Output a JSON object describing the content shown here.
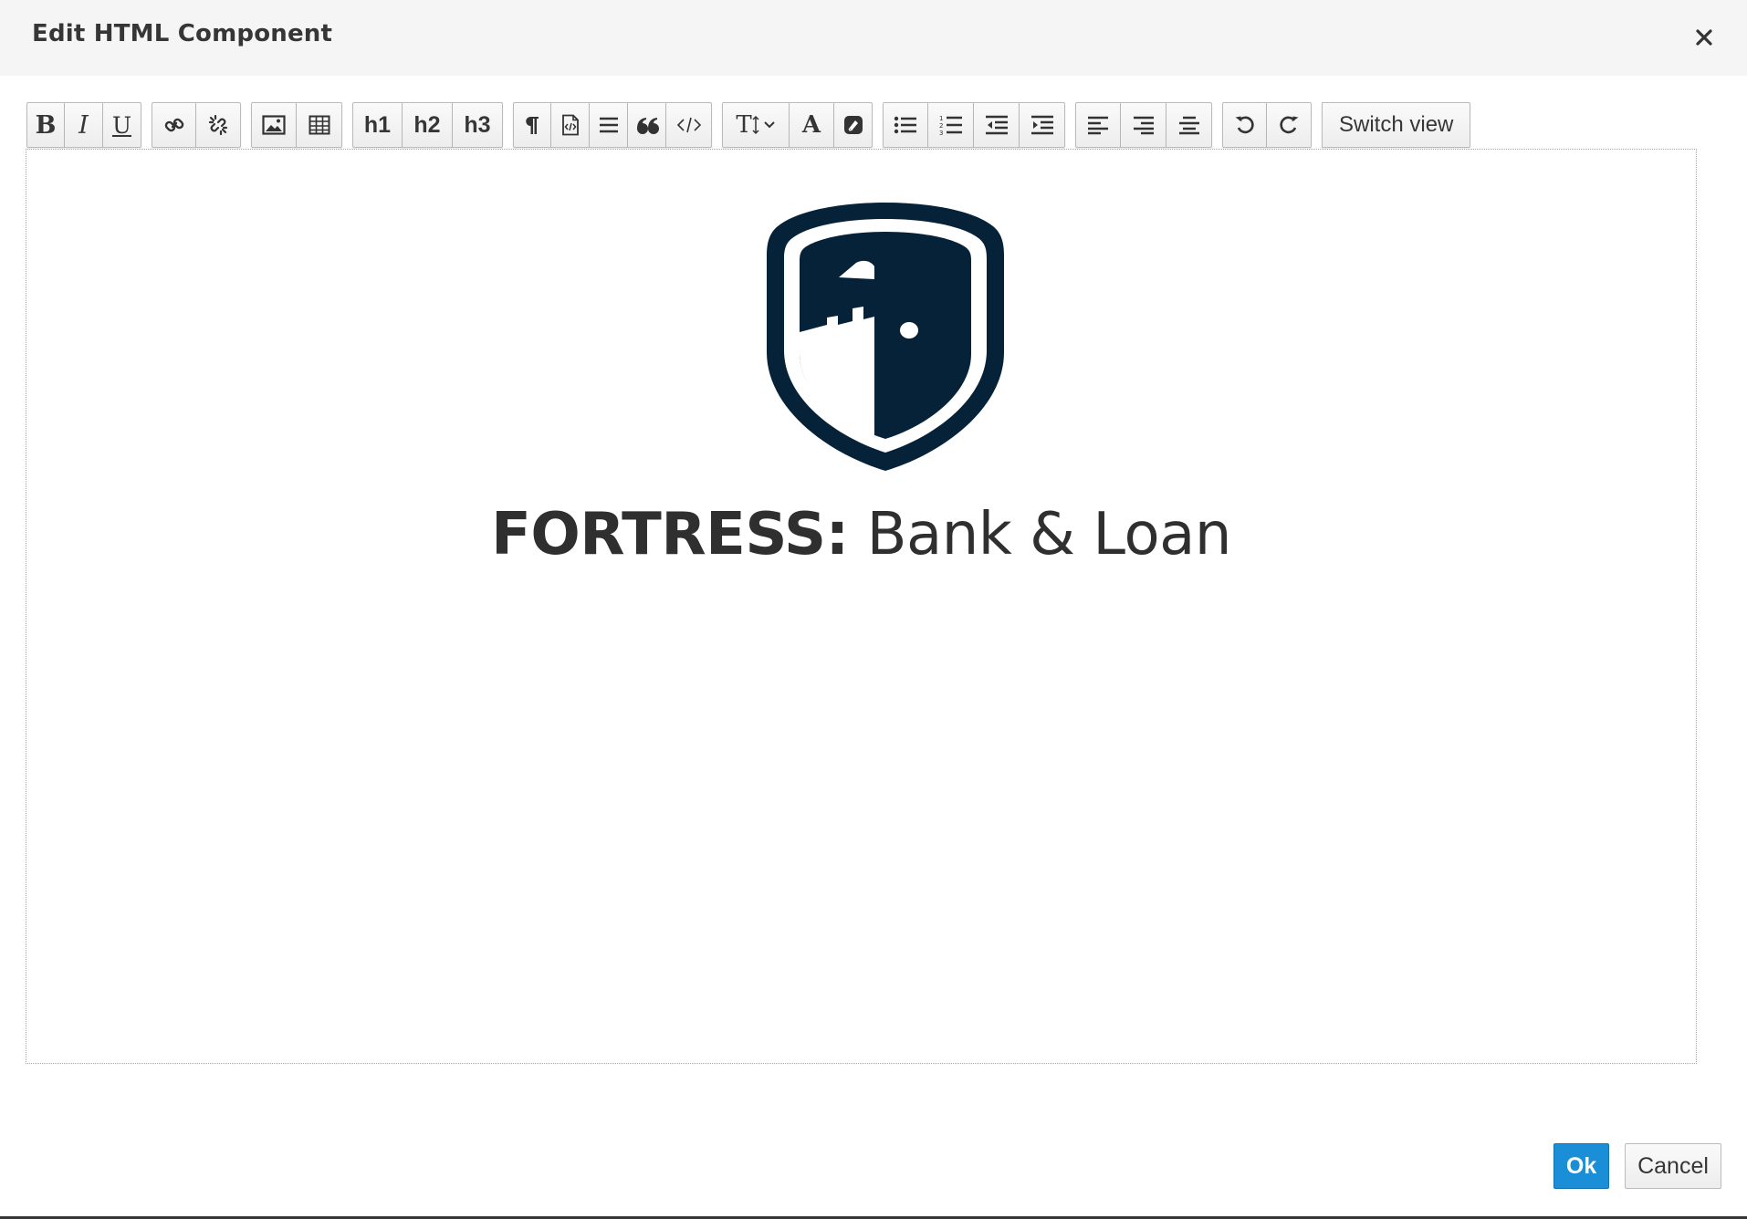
{
  "dialog": {
    "title": "Edit HTML Component",
    "close_icon": "close-icon"
  },
  "toolbar": {
    "groups": [
      {
        "name": "text-style",
        "buttons": [
          {
            "label": "B",
            "icon": "bold-icon"
          },
          {
            "label": "I",
            "icon": "italic-icon"
          },
          {
            "label": "U",
            "icon": "underline-icon"
          }
        ]
      },
      {
        "name": "links",
        "buttons": [
          {
            "icon": "link-icon"
          },
          {
            "icon": "unlink-icon"
          }
        ]
      },
      {
        "name": "insert",
        "buttons": [
          {
            "icon": "image-icon"
          },
          {
            "icon": "table-icon"
          }
        ]
      },
      {
        "name": "headings",
        "buttons": [
          {
            "label": "h1"
          },
          {
            "label": "h2"
          },
          {
            "label": "h3"
          }
        ]
      },
      {
        "name": "blocks",
        "buttons": [
          {
            "icon": "paragraph-icon"
          },
          {
            "icon": "code-file-icon"
          },
          {
            "icon": "align-justify-icon"
          },
          {
            "icon": "quote-icon"
          },
          {
            "icon": "code-icon"
          }
        ]
      },
      {
        "name": "font",
        "buttons": [
          {
            "label": "T",
            "icon": "font-size-icon"
          },
          {
            "label": "A",
            "icon": "font-color-icon"
          },
          {
            "icon": "eraser-icon"
          }
        ]
      },
      {
        "name": "lists",
        "buttons": [
          {
            "icon": "bullet-list-icon"
          },
          {
            "icon": "numbered-list-icon"
          },
          {
            "icon": "outdent-icon"
          },
          {
            "icon": "indent-icon"
          }
        ]
      },
      {
        "name": "alignment",
        "buttons": [
          {
            "icon": "align-left-icon"
          },
          {
            "icon": "align-right-icon"
          },
          {
            "icon": "align-center-icon"
          }
        ]
      },
      {
        "name": "history",
        "buttons": [
          {
            "icon": "undo-icon"
          },
          {
            "icon": "redo-icon"
          }
        ]
      }
    ],
    "switch_view_label": "Switch view"
  },
  "editor": {
    "logo_icon": "fortress-shield-logo",
    "heading_strong": "FORTRESS:",
    "heading_rest": " Bank & Loan"
  },
  "footer": {
    "ok_label": "Ok",
    "cancel_label": "Cancel"
  },
  "colors": {
    "header_bg": "#f5f5f5",
    "primary": "#1a8fd7",
    "logo": "#062239",
    "text": "#363636"
  }
}
